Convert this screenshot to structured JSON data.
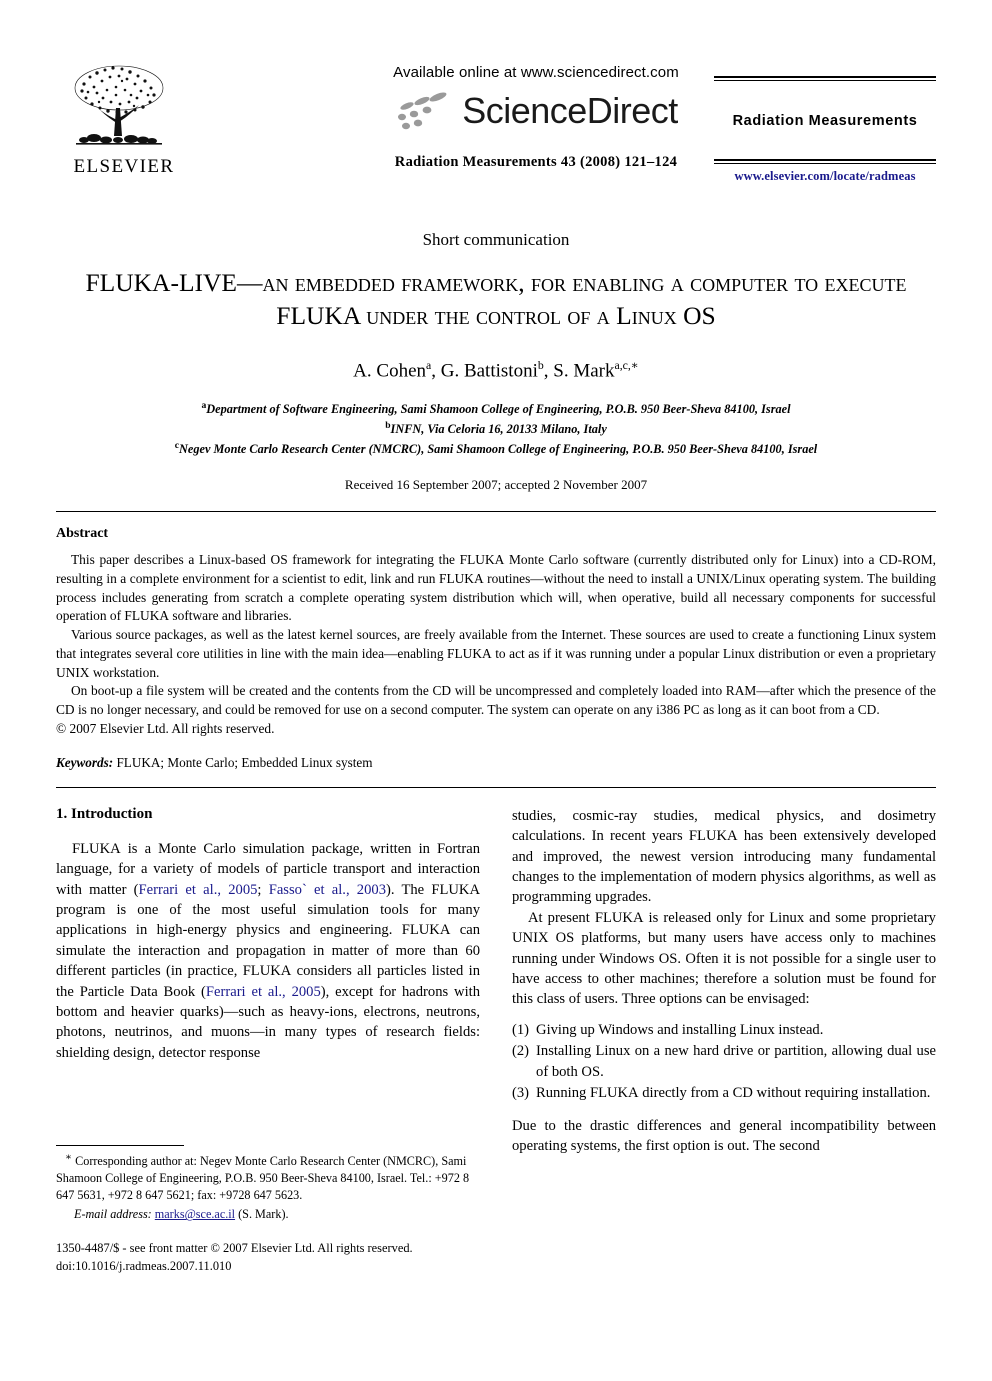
{
  "header": {
    "publisher_logo_label": "ELSEVIER",
    "available_online": "Available online at www.sciencedirect.com",
    "sciencedirect_logo_text": "ScienceDirect",
    "journal_reference": "Radiation Measurements 43 (2008) 121–124",
    "journal_name": "Radiation Measurements",
    "journal_url": "www.elsevier.com/locate/radmeas"
  },
  "article": {
    "section_kind": "Short communication",
    "title_line1_pre": "F",
    "title_line1": "LUKA-LIVE—an embedded framework, for enabling a computer to execute",
    "title_line2": "LUKA under the control of a Linux OS",
    "authors": "A. Cohen",
    "author_sup_1": "a",
    "author_2": ", G. Battistoni",
    "author_sup_2": "b",
    "author_3": ", S. Mark",
    "author_sup_3": "a,c,∗",
    "affiliation_a_sup": "a",
    "affiliation_a": "Department of Software Engineering, Sami Shamoon College of Engineering, P.O.B. 950 Beer-Sheva 84100, Israel",
    "affiliation_b_sup": "b",
    "affiliation_b": "INFN, Via Celoria 16, 20133 Milano, Italy",
    "affiliation_c_sup": "c",
    "affiliation_c": "Negev Monte Carlo Research Center (NMCRC), Sami Shamoon College of Engineering, P.O.B. 950 Beer-Sheva 84100, Israel",
    "received": "Received 16 September 2007; accepted 2 November 2007"
  },
  "abstract": {
    "heading": "Abstract",
    "p1_a": "This paper describes a Linux-based OS framework for integrating the F",
    "p1_sc1": "LUKA",
    "p1_b": " Monte Carlo software (currently distributed only for Linux) into a CD-ROM, resulting in a complete environment for a scientist to edit, link and run F",
    "p1_sc2": "LUKA",
    "p1_c": " routines—without the need to install a UNIX/Linux operating system. The building process includes generating from scratch a complete operating system distribution which will, when operative, build all necessary components for successful operation of F",
    "p1_sc3": "LUKA",
    "p1_d": " software and libraries.",
    "p2_a": "Various source packages, as well as the latest kernel sources, are freely available from the Internet. These sources are used to create a functioning Linux system that integrates several core utilities in line with the main idea—enabling F",
    "p2_sc1": "LUKA",
    "p2_b": " to act as if it was running under a popular Linux distribution or even a proprietary UNIX workstation.",
    "p3": "On boot-up a file system will be created and the contents from the CD will be uncompressed and completely loaded into RAM—after which the presence of the CD is no longer necessary, and could be removed for use on a second computer. The system can operate on any i386 PC as long as it can boot from a CD.",
    "copyright": "© 2007 Elsevier Ltd. All rights reserved."
  },
  "keywords": {
    "label": "Keywords:",
    "kw1_sc": "FLUKA",
    "rest": "; Monte Carlo; Embedded Linux system"
  },
  "introduction": {
    "heading": "1. Introduction",
    "p1_sc1": "FLUKA",
    "p1_a": " is a Monte Carlo simulation package, written in Fortran language, for a variety of models of particle transport and interaction with matter (",
    "p1_cite1": "Ferrari et al., 2005",
    "p1_b": "; ",
    "p1_cite2": "Fasso` et al., 2003",
    "p1_c": "). The ",
    "p1_sc2": "FLUKA",
    "p1_d": " program is one of the most useful simulation tools for many applications in high-energy physics and engineering. ",
    "p1_sc3": "FLUKA",
    "p1_e": " can simulate the interaction and propagation in matter of more than 60 different particles (in practice, ",
    "p1_sc4": "FLUKA",
    "p1_f": " considers all particles listed in the Particle Data Book (",
    "p1_cite3": "Ferrari et al., 2005",
    "p1_g": "), except for hadrons with bottom and heavier quarks)—such as heavy-ions, electrons, neutrons, photons, neutrinos, and muons—in many types of research fields: shielding design, detector response studies, cosmic-ray studies, medical physics, and dosimetry calculations. In recent years ",
    "p1_sc5": "FLUKA",
    "p1_h": " has been extensively developed and improved, the newest version introducing many fundamental changes to the implementation of modern physics algorithms, as well as programming upgrades.",
    "p2_a": "At present ",
    "p2_sc1": "FLUKA",
    "p2_b": " is released only for Linux and some proprietary UNIX OS platforms, but many users have access only to machines running under Windows OS. Often it is not possible for a single user to have access to other machines; therefore a solution must be found for this class of users. Three options can be envisaged:",
    "option1_num": "(1)",
    "option1": "Giving up Windows and installing Linux instead.",
    "option2_num": "(2)",
    "option2": "Installing Linux on a new hard drive or partition, allowing dual use of both OS.",
    "option3_num": "(3)",
    "option3_a": "Running ",
    "option3_sc": "FLUKA",
    "option3_b": " directly from a CD without requiring installation.",
    "p3": "Due to the drastic differences and general incompatibility between operating systems, the first option is out. The second"
  },
  "footnote": {
    "star": "∗",
    "corresponding": " Corresponding author at: Negev Monte Carlo Research Center (NMCRC), Sami Shamoon College of Engineering, P.O.B. 950 Beer-Sheva 84100, Israel. Tel.: +972 8 647 5631, +972 8 647 5621; fax: +9728 647 5623.",
    "email_label": "E-mail address:",
    "email": "marks@sce.ac.il",
    "email_owner": "(S. Mark)."
  },
  "issn": {
    "line1": "1350-4487/$ - see front matter © 2007 Elsevier Ltd. All rights reserved.",
    "line2": "doi:10.1016/j.radmeas.2007.11.010"
  },
  "colors": {
    "link": "#1a1a8c",
    "text": "#000000"
  }
}
